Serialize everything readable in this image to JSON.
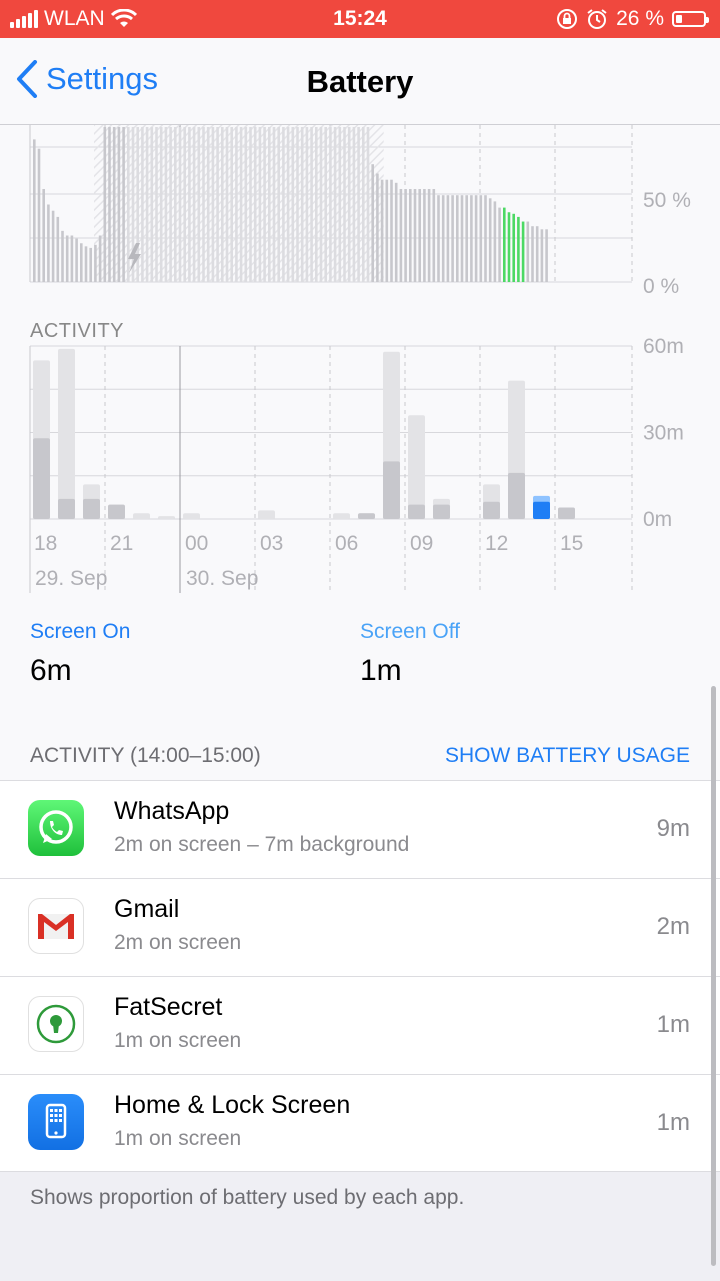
{
  "status_bar": {
    "carrier": "WLAN",
    "time": "15:24",
    "battery_percent": "26 %",
    "battery_level": 0.26,
    "icons": [
      "signal-icon",
      "wifi-icon",
      "orientation-lock-icon",
      "alarm-icon",
      "battery-icon"
    ]
  },
  "nav": {
    "back_label": "Settings",
    "title": "Battery"
  },
  "battery_chart": {
    "y_labels": [
      "50 %",
      "0 %"
    ],
    "charge_icon": "lightning-icon"
  },
  "activity_chart": {
    "label": "ACTIVITY",
    "y_labels": [
      "60m",
      "30m",
      "0m"
    ],
    "x_labels": [
      "18",
      "21",
      "00",
      "03",
      "06",
      "09",
      "12",
      "15"
    ],
    "date_labels": [
      "29. Sep",
      "30. Sep"
    ]
  },
  "chart_data": [
    {
      "type": "bar",
      "title": "",
      "ylabel": "",
      "ylim": [
        0,
        100
      ],
      "values": [
        92,
        86,
        60,
        50,
        46,
        42,
        33,
        30,
        30,
        28,
        25,
        23,
        22,
        24,
        30,
        100,
        100,
        100,
        100,
        100,
        100,
        100,
        100,
        100,
        100,
        100,
        100,
        100,
        100,
        100,
        100,
        100,
        100,
        100,
        100,
        100,
        100,
        100,
        100,
        100,
        100,
        100,
        100,
        100,
        100,
        100,
        100,
        100,
        100,
        100,
        100,
        100,
        100,
        100,
        100,
        100,
        100,
        100,
        100,
        100,
        100,
        100,
        100,
        100,
        100,
        100,
        100,
        100,
        100,
        100,
        100,
        100,
        76,
        70,
        66,
        66,
        66,
        64,
        60,
        60,
        60,
        60,
        60,
        60,
        60,
        60,
        56,
        56,
        56,
        56,
        56,
        56,
        56,
        56,
        56,
        56,
        56,
        54,
        52,
        48,
        48,
        45,
        44,
        42,
        39,
        39,
        36,
        36,
        34,
        34
      ],
      "charging_index_start": 20,
      "charging_index_end": 71,
      "highlight_index_start": 100,
      "highlight_index_end": 104
    },
    {
      "type": "bar",
      "title": "",
      "ylabel": "",
      "ylim": [
        0,
        60
      ],
      "categories": [
        "18",
        "19",
        "20",
        "21",
        "22",
        "23",
        "00",
        "01",
        "02",
        "03",
        "04",
        "05",
        "06",
        "07",
        "08",
        "09",
        "10",
        "11",
        "12",
        "13",
        "14",
        "15"
      ],
      "series": [
        {
          "values": [
            55,
            59,
            12,
            5,
            2,
            1,
            2,
            0,
            0,
            3,
            0,
            0,
            2,
            2,
            58,
            36,
            7,
            0,
            12,
            48,
            8,
            4
          ]
        },
        {
          "values": [
            28,
            7,
            7,
            5,
            0,
            0,
            0,
            0,
            0,
            0,
            0,
            0,
            0,
            2,
            20,
            5,
            5,
            0,
            6,
            16,
            6,
            4
          ]
        }
      ],
      "highlight_category": "14"
    }
  ],
  "screen_stats": {
    "on_label": "Screen On",
    "on_value": "6m",
    "off_label": "Screen Off",
    "off_value": "1m"
  },
  "activity_section": {
    "title": "ACTIVITY (14:00–15:00)",
    "link": "SHOW BATTERY USAGE"
  },
  "apps": [
    {
      "name": "WhatsApp",
      "detail": "2m on screen – 7m background",
      "time": "9m",
      "icon": "whatsapp-icon"
    },
    {
      "name": "Gmail",
      "detail": "2m on screen",
      "time": "2m",
      "icon": "gmail-icon"
    },
    {
      "name": "FatSecret",
      "detail": "1m on screen",
      "time": "1m",
      "icon": "fatsecret-icon"
    },
    {
      "name": "Home & Lock Screen",
      "detail": "1m on screen",
      "time": "1m",
      "icon": "home-screen-icon"
    }
  ],
  "footer": {
    "note": "Shows proportion of battery used by each app."
  },
  "colors": {
    "status_bar": "#f0483e",
    "accent": "#1f7ef5",
    "charging_green": "#4cd964",
    "bar_gray": "#c7c7cc",
    "bar_light": "#e3e3e6"
  }
}
